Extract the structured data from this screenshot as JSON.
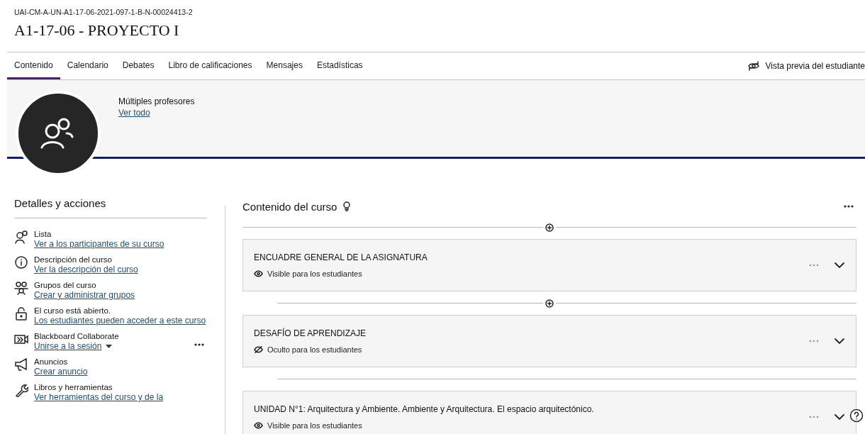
{
  "course": {
    "code": "UAI-CM-A-UN-A1-17-06-2021-097-1-B-N-00024413-2",
    "title": "A1-17-06 - PROYECTO I"
  },
  "tabs": [
    {
      "label": "Contenido",
      "selected": true
    },
    {
      "label": "Calendario",
      "selected": false
    },
    {
      "label": "Debates",
      "selected": false
    },
    {
      "label": "Libro de calificaciones",
      "selected": false
    },
    {
      "label": "Mensajes",
      "selected": false
    },
    {
      "label": "Estadísticas",
      "selected": false
    }
  ],
  "student_preview": {
    "label": "Vista previa del estudiante"
  },
  "banner": {
    "instructors": "Múltiples profesores",
    "link": "Ver todo"
  },
  "sidebar": {
    "heading": "Detalles y acciones",
    "items": [
      {
        "title": "Lista",
        "link": "Ver a los participantes de su curso"
      },
      {
        "title": "Descripción del curso",
        "link": "Ver la descripción del curso"
      },
      {
        "title": "Grupos del curso",
        "link": "Crear y administrar grupos"
      },
      {
        "title": "El curso está abierto.",
        "link": "Los estudiantes pueden acceder a este curso"
      },
      {
        "title": "Blackboard Collaborate",
        "link": "Unirse a la sesión",
        "dropdown": true,
        "more": true
      },
      {
        "title": "Anuncios",
        "link": "Crear anuncio"
      },
      {
        "title": "Libros y herramientas",
        "link": "Ver herramientas del curso y de la"
      }
    ]
  },
  "content": {
    "heading": "Contenido del curso",
    "items": [
      {
        "title": "ENCUADRE GENERAL DE LA ASIGNATURA",
        "status": "Visible para los estudiantes",
        "visible": true,
        "add_above": true
      },
      {
        "title": "DESAFÍO DE APRENDIZAJE",
        "status": "Oculto para los estudiantes",
        "visible": false,
        "add_above": true
      },
      {
        "title": "UNIDAD N°1: Arquitectura y Ambiente. Ambiente y Arquitectura. El espacio arquitectónico.",
        "status": "Visible para los estudiantes",
        "visible": true,
        "add_above": false
      }
    ]
  }
}
